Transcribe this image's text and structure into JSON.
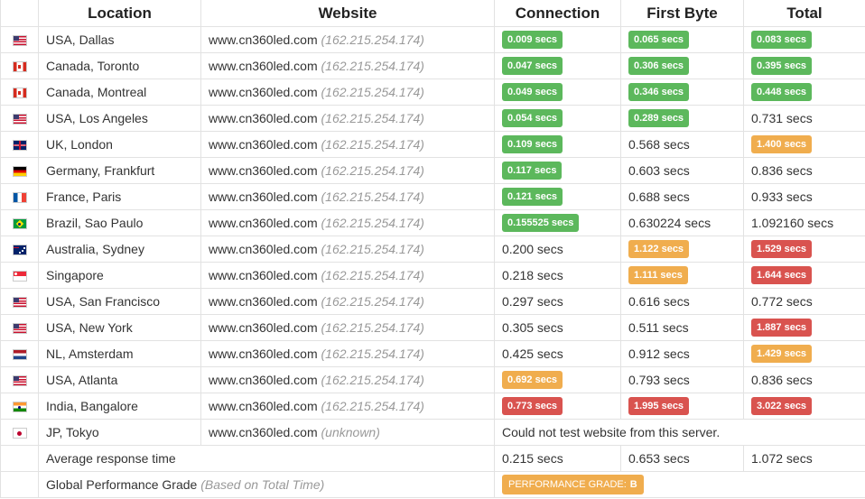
{
  "headers": [
    "",
    "Location",
    "Website",
    "Connection",
    "First Byte",
    "Total"
  ],
  "rows": [
    {
      "flag": "us",
      "location": "USA, Dallas",
      "site": "www.cn360led.com",
      "ip": "(162.215.254.174)",
      "connection": {
        "v": "0.009 secs",
        "c": "g"
      },
      "first_byte": {
        "v": "0.065 secs",
        "c": "g"
      },
      "total": {
        "v": "0.083 secs",
        "c": "g"
      }
    },
    {
      "flag": "ca",
      "location": "Canada, Toronto",
      "site": "www.cn360led.com",
      "ip": "(162.215.254.174)",
      "connection": {
        "v": "0.047 secs",
        "c": "g"
      },
      "first_byte": {
        "v": "0.306 secs",
        "c": "g"
      },
      "total": {
        "v": "0.395 secs",
        "c": "g"
      }
    },
    {
      "flag": "ca",
      "location": "Canada, Montreal",
      "site": "www.cn360led.com",
      "ip": "(162.215.254.174)",
      "connection": {
        "v": "0.049 secs",
        "c": "g"
      },
      "first_byte": {
        "v": "0.346 secs",
        "c": "g"
      },
      "total": {
        "v": "0.448 secs",
        "c": "g"
      }
    },
    {
      "flag": "us",
      "location": "USA, Los Angeles",
      "site": "www.cn360led.com",
      "ip": "(162.215.254.174)",
      "connection": {
        "v": "0.054 secs",
        "c": "g"
      },
      "first_byte": {
        "v": "0.289 secs",
        "c": "g"
      },
      "total": {
        "v": "0.731 secs",
        "c": ""
      }
    },
    {
      "flag": "uk",
      "location": "UK, London",
      "site": "www.cn360led.com",
      "ip": "(162.215.254.174)",
      "connection": {
        "v": "0.109 secs",
        "c": "g"
      },
      "first_byte": {
        "v": "0.568 secs",
        "c": ""
      },
      "total": {
        "v": "1.400 secs",
        "c": "o"
      }
    },
    {
      "flag": "de",
      "location": "Germany, Frankfurt",
      "site": "www.cn360led.com",
      "ip": "(162.215.254.174)",
      "connection": {
        "v": "0.117 secs",
        "c": "g"
      },
      "first_byte": {
        "v": "0.603 secs",
        "c": ""
      },
      "total": {
        "v": "0.836 secs",
        "c": ""
      }
    },
    {
      "flag": "fr",
      "location": "France, Paris",
      "site": "www.cn360led.com",
      "ip": "(162.215.254.174)",
      "connection": {
        "v": "0.121 secs",
        "c": "g"
      },
      "first_byte": {
        "v": "0.688 secs",
        "c": ""
      },
      "total": {
        "v": "0.933 secs",
        "c": ""
      }
    },
    {
      "flag": "br",
      "location": "Brazil, Sao Paulo",
      "site": "www.cn360led.com",
      "ip": "(162.215.254.174)",
      "connection": {
        "v": "0.155525 secs",
        "c": "g"
      },
      "first_byte": {
        "v": "0.630224 secs",
        "c": ""
      },
      "total": {
        "v": "1.092160 secs",
        "c": ""
      }
    },
    {
      "flag": "au",
      "location": "Australia, Sydney",
      "site": "www.cn360led.com",
      "ip": "(162.215.254.174)",
      "connection": {
        "v": "0.200 secs",
        "c": ""
      },
      "first_byte": {
        "v": "1.122 secs",
        "c": "o"
      },
      "total": {
        "v": "1.529 secs",
        "c": "r"
      }
    },
    {
      "flag": "sg",
      "location": "Singapore",
      "site": "www.cn360led.com",
      "ip": "(162.215.254.174)",
      "connection": {
        "v": "0.218 secs",
        "c": ""
      },
      "first_byte": {
        "v": "1.111 secs",
        "c": "o"
      },
      "total": {
        "v": "1.644 secs",
        "c": "r"
      }
    },
    {
      "flag": "us",
      "location": "USA, San Francisco",
      "site": "www.cn360led.com",
      "ip": "(162.215.254.174)",
      "connection": {
        "v": "0.297 secs",
        "c": ""
      },
      "first_byte": {
        "v": "0.616 secs",
        "c": ""
      },
      "total": {
        "v": "0.772 secs",
        "c": ""
      }
    },
    {
      "flag": "us",
      "location": "USA, New York",
      "site": "www.cn360led.com",
      "ip": "(162.215.254.174)",
      "connection": {
        "v": "0.305 secs",
        "c": ""
      },
      "first_byte": {
        "v": "0.511 secs",
        "c": ""
      },
      "total": {
        "v": "1.887 secs",
        "c": "r"
      }
    },
    {
      "flag": "nl",
      "location": "NL, Amsterdam",
      "site": "www.cn360led.com",
      "ip": "(162.215.254.174)",
      "connection": {
        "v": "0.425 secs",
        "c": ""
      },
      "first_byte": {
        "v": "0.912 secs",
        "c": ""
      },
      "total": {
        "v": "1.429 secs",
        "c": "o"
      }
    },
    {
      "flag": "us",
      "location": "USA, Atlanta",
      "site": "www.cn360led.com",
      "ip": "(162.215.254.174)",
      "connection": {
        "v": "0.692 secs",
        "c": "o"
      },
      "first_byte": {
        "v": "0.793 secs",
        "c": ""
      },
      "total": {
        "v": "0.836 secs",
        "c": ""
      }
    },
    {
      "flag": "in",
      "location": "India, Bangalore",
      "site": "www.cn360led.com",
      "ip": "(162.215.254.174)",
      "connection": {
        "v": "0.773 secs",
        "c": "r"
      },
      "first_byte": {
        "v": "1.995 secs",
        "c": "r"
      },
      "total": {
        "v": "3.022 secs",
        "c": "r"
      }
    },
    {
      "flag": "jp",
      "location": "JP, Tokyo",
      "site": "www.cn360led.com",
      "ip": "(unknown)",
      "message": "Could not test website from this server."
    }
  ],
  "average": {
    "label": "Average response time",
    "connection": "0.215 secs",
    "first_byte": "0.653 secs",
    "total": "1.072 secs"
  },
  "grade": {
    "label": "Global Performance Grade",
    "note": "(Based on Total Time)",
    "badge_label": "PERFORMANCE GRADE:",
    "badge_value": "B"
  },
  "colors": {
    "g": "#5cb85c",
    "o": "#f0ad4e",
    "r": "#d9534f",
    "grade": "#f0ad4e"
  }
}
